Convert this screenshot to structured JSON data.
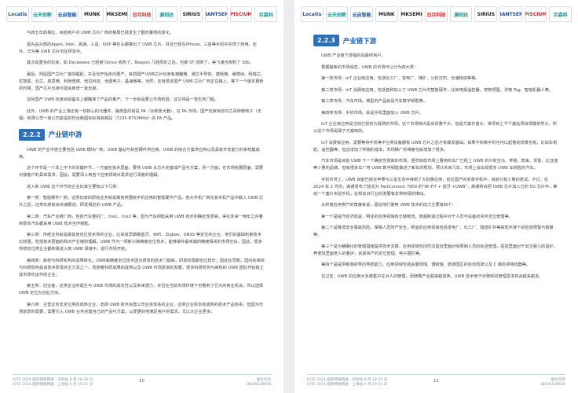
{
  "logos": [
    {
      "name": "Locatis",
      "style": "blue"
    },
    {
      "name": "云天创新",
      "style": "teal"
    },
    {
      "name": "云启智能",
      "style": "blue"
    },
    {
      "name": "MUNK",
      "style": "dark"
    },
    {
      "name": "MKSEMI",
      "style": "dark"
    },
    {
      "name": "日月科技",
      "style": "red"
    },
    {
      "name": "源创达",
      "style": "teal"
    },
    {
      "name": "SIRIUS",
      "style": "dark"
    },
    {
      "name": "GIANTSEMI",
      "style": "blue"
    },
    {
      "name": "PISCIUM",
      "style": "red"
    },
    {
      "name": "巨森科",
      "style": "teal"
    }
  ],
  "left_page": {
    "paragraphs_top": [
      "与四五年前相比，目前用户对 UWB 芯片厂商的格局已经发生了翻天覆地的变化。",
      "首先是头部的Apple, Intel、高通、三星、NXP 等巨头都推出了 UWB 芯片，并且已经在iPhone、三星等手机中实现了商用。此外，华为等 UWB 芯片也在研发中。",
      "其次是更多的玩家，如 Decawave 已经被 Qorvo 收购了，Beepon 几经周折之后，也被 ST 收购了，美飞渡也收购了 3db。",
      "最后，则是国产芯片厂家的崛起，并且也开始走向量产。目前国产UWB芯片玩家有瀚巍微、驰芯半导体、捷扬微、睿德纳、纽瑞芯、优智联、云芯、航思微、利随普德、倍拉科技、全图电子、晶海微等。当然，还有很多国产 UWB 芯片厂商正在路上，等下一个版本更新的时候，国产芯片玩家可能会新增一批玩家。",
      "这些国产 UWB 玩家目前基本上都瞄准了产品的量产。下一步就是要让市场检验，这又将是一道生死门槛。",
      "此外，UWB 的产业上游还有一些核心的元器件。最典型的就是 PA（功率放大器）。在 PA 市场，国产玩家目前仅芯百特微电子（无锡）有限公司一家公司能提供符合新国标标准高频段（7235-8750MHz）的 PA 产品。"
    ],
    "section": {
      "number": "2.2.2",
      "title": "产业链中游"
    },
    "paragraphs_bottom": [
      "UWB 的产业中游主要包括 UWB 模块厂商、UWB 基站与标签硬件供应商、UWB 的综合方案供应商以及具有开发能力的系统集成商。",
      "这个环节是一个非上中下的关键环节，一方面在技术层面，要将 UWB 从芯片完善成产品与方案，另一方面，在市场拓展层面，需要对接客户的具体需求，因此，需要深入到各个应用领域对需求进行深度的理解。",
      "进入到 UWB 这个环节的企业玩家主要有以下几类：",
      "第一类：智能硬件厂商，这类玩家的原有业务就是做各类围绕手机应用的智能硬件产品，各大手机厂商在其手机产品中嵌入 UWB 芯片之后，这类玩家就会快速跟进，研发相应的 UWB 产品。",
      "第二类：汽车产业链厂商，包括汽车整机厂、tire1、tire2 等，因为汽车钥匙采用 UWB 技术的确定性很高，得在未来一两年之内看到很多汽车都采用 UWB 技术当作钥匙。",
      "第三类：传统业务就是做其他定位技术类的企业，比如说早期做蓝牙、WiFi、Zigbee、GNSS 等定位的企业，他们的基础积累技术比较强，包括技术层面的和对产业链的理解，UWB 作为一项新兴高精度定位技术，能够填补最末端的精度相关的市场空白，因此，很多传统定位类企业都积极进入到 UWB 领域中，进行市场开拓。",
      "第四类：高校与科研机构的成果转化，UWB高精度定位技术因为研发的技术门槛高，研发的周期也比较长；因此在早期，国内的高校与科研机构是该技术研发的主力军之一，而随着科研成果的成熟以及 UWB 市场逐渐的发展，很多科研机构与高校的 UWB 团队开始独立成市场化运作的企业。",
      "第五类：创业者，这类企业的诞生与 UWB 市场的成长性以及未来潜力，并且在当前市场环境下也看到了巨大的商业机会，所以选择 UWB 定位为创业方向。",
      "第六类：主营业务非定位类的成熟企业，选择 UWB 技术完善公司业务体系的企业，这类企业原本有成熟的技术产品体系，但因为市场前景的需要，需要引入 UWB 业务完善自己的产品与方案，以便更好地满足用户的需求，尤以大企业居多。"
    ],
    "footer": {
      "left_line1": "IOTE 2024 国际物联网展 · 深圳站 8 月 28-30 日",
      "left_line2": "IOTE 2024 国际物联网展 · 上海站 6 月 19-21 日",
      "page_number": "10",
      "right_line1": "展位咨询",
      "right_line2": "18926538648"
    }
  },
  "right_page": {
    "section": {
      "number": "2.2.3",
      "title": "产业链下游"
    },
    "paragraphs": [
      "UWB 产业链下游指的是最终用户。",
      "根据最新的市场信息，UWB 的市场可以分为四大类：",
      "第一类市场：IoT 企业级应用。包括化工厂、变电厂、煤矿、公检法司、仓储物流等等。",
      "第二类市场：IoT 消费级应用。包括各种加入了 UWB 芯片的智能硬件，比如电视遥控器、宠物项圈、寻物 Tag、智能机器人等。",
      "第三类市场：汽车市场。典型的产品就是汽车数字钥匙等。",
      "第四类市场：手机市场。就是手机里面加入 UWB 芯片。",
      "IoT 企业级应用是当前已经较为成熟的市场，这个市场特点是出货量不大，但是方案价值大，单项目上千个基站项目规模依然大，所以这个市场是属于方案商的。",
      "IoT 消费级应用，需要等待手机等平台类设备都有 UWB 芯片之后才有爆发基础。如果不依赖手机也可以起量的场景也有，比如车钥匙、遥控器等，但这增加了终端的成本，市场推广的难度也就增加了很多。",
      "汽车市场是目前 UWB 下一个确定性很高的市场，虽然目前市场上看到的车厂已经上 UWB 的只有宝马、奔驰、蔚来、零氪、比亚迪等少量的品牌，但有很多车厂将 UWB 数字钥匙做进了新车的规划，预计未来几年，市场上会出现很多 UWB 车钥匙的汽车。",
      "手机市场上，UWB 目前已经在苹果与三星生态中得到了大批量应用，但在国产的安卓手机中，目前只有少量的尝试。不过，在 2024 年 2 月份，高通发布了骁龙为 FastConnect 7900 的\"Wi-Fi7 + 蓝牙 +UWB\"，高通将会把 UWB 芯片加入它的 5G 芯片中，推动一个套片实验手机，这样会对行业的发展有非常积极的推动。",
      "从终端应用类产的角度来说，驱动他们使用 UWB 技术的动力主要有四个：",
      "第一个是提升经济效益，明亚的应用领域有仓储物流，商超制造过程中对于人员与设备的实时定位管理等。",
      "第二个是降低安全事故风险，保障人员财产安全，明亚的应用领域包括发电厂、化工厂、隧道矿井等高危环境下的险情预警与救援等。",
      "第三个是为精确化的管理措施提供技术支撑，应用领域包括司法监狱里面对受限制人员的轨迹管理，医院里面对于出生婴儿的监护，养老院里面老人的看护，资源资产的定位管理、电子围栏等。",
      "第四个是提供精准的导向导航能力，应用领域包括会展场馆、博物馆、旅游园区的自动驾驶以及 C 端的寻物找器等。",
      "在过去，UWB 的应用大多数集中在对人的管理，而随着产业越来越成熟，UWB 技术用于对物体的管理需求将会越来越多。"
    ],
    "footer": {
      "left_line1": "IOTE 2024 国际物联网展 · 深圳站 8 月 28-30 日",
      "left_line2": "IOTE 2024 国际物联网展 · 上海站 6 月 19-21 日",
      "page_number": "11",
      "right_line1": "展位咨询",
      "right_line2": "18926538648"
    }
  }
}
